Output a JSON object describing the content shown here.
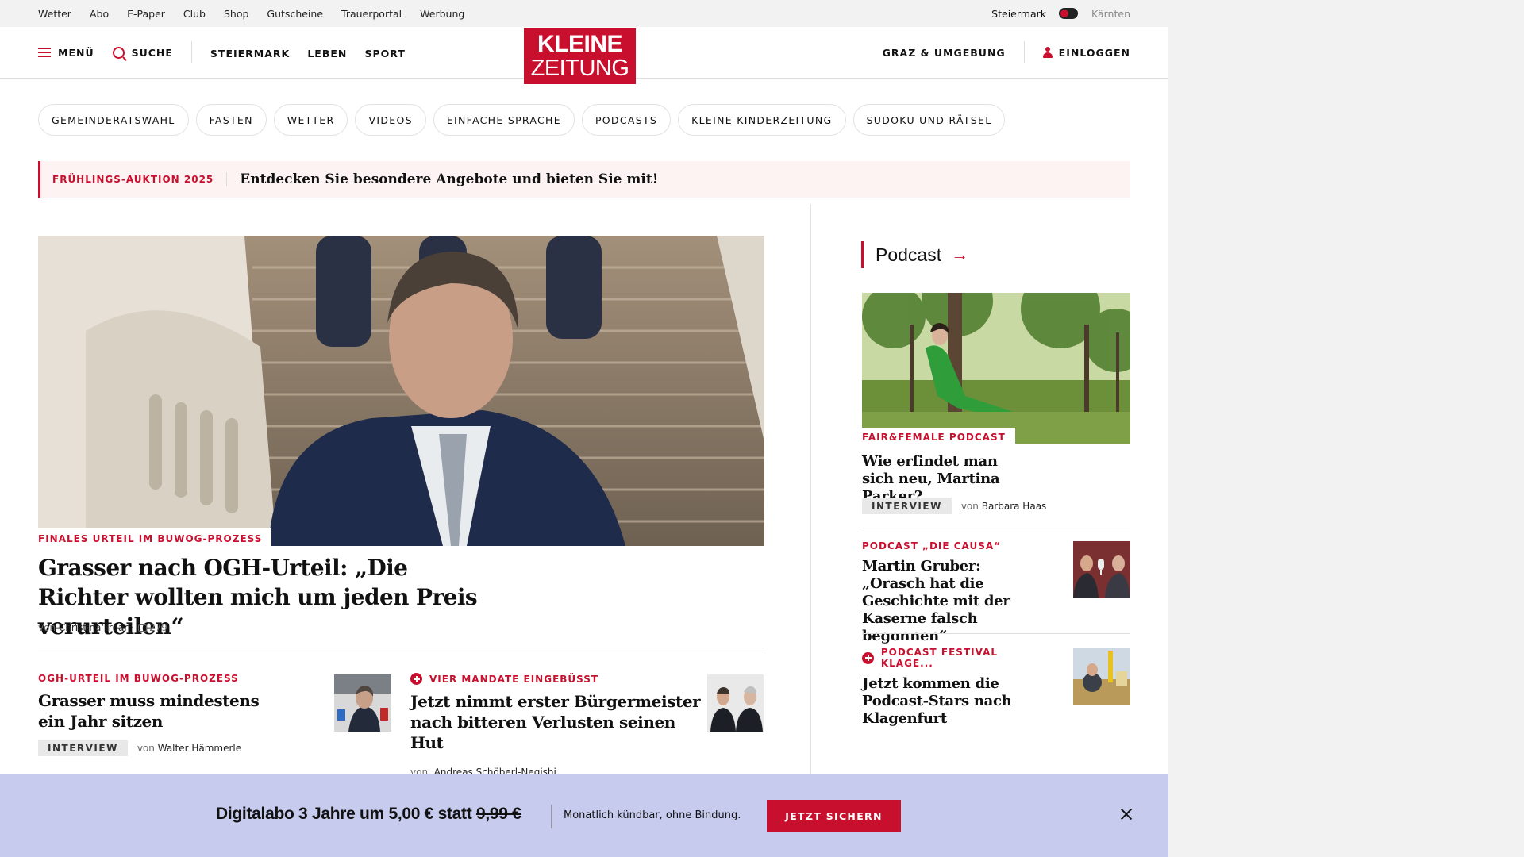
{
  "util_bar": {
    "links": [
      "Wetter",
      "Abo",
      "E-Paper",
      "Club",
      "Shop",
      "Gutscheine",
      "Trauerportal",
      "Werbung"
    ],
    "region_active": "Steiermark",
    "region_inactive": "Kärnten"
  },
  "header": {
    "menu_label": "MENÜ",
    "search_label": "SUCHE",
    "nav": [
      "STEIERMARK",
      "LEBEN",
      "SPORT"
    ],
    "logo_line1": "KLEINE",
    "logo_line2": "ZEITUNG",
    "region_link": "GRAZ & UMGEBUNG",
    "login_label": "EINLOGGEN"
  },
  "topics": [
    "GEMEINDERATSWAHL",
    "FASTEN",
    "WETTER",
    "VIDEOS",
    "EINFACHE SPRACHE",
    "PODCASTS",
    "KLEINE KINDERZEITUNG",
    "SUDOKU UND RÄTSEL"
  ],
  "promo": {
    "tag": "FRÜHLINGS-AUKTION 2025",
    "text": "Entdecken Sie besondere Angebote und bieten Sie mit!"
  },
  "hero": {
    "kicker": "FINALES URTEIL IM BUWOG-PROZESS",
    "title": "Grasser nach OGH-Urteil: „Die Richter wollten mich um jeden Preis verurteilen“",
    "by_prefix": "von",
    "author": "Christina Traar",
    "separator": "·",
    "comments": "279"
  },
  "articles": [
    {
      "kicker": "OGH-URTEIL IM BUWOG-PROZESS",
      "title": "Grasser muss mindestens ein Jahr sitzen",
      "badge": "INTERVIEW",
      "by_prefix": "von",
      "author": "Walter Hämmerle"
    },
    {
      "kicker": "VIER MANDATE EINGEBÜSST",
      "title": "Jetzt nimmt erster Bürgermeister nach bitteren Verlusten seinen Hut",
      "by_prefix": "von",
      "author": "Andreas Schöberl-Negishi"
    }
  ],
  "podcast": {
    "heading": "Podcast",
    "arrow": "→",
    "items": [
      {
        "kicker": "FAIR&FEMALE PODCAST",
        "title": "Wie erfindet man sich neu, Martina Parker?",
        "badge": "INTERVIEW",
        "by_prefix": "von",
        "author": "Barbara Haas"
      },
      {
        "kicker": "PODCAST „DIE CAUSA“",
        "title": "Martin Gruber: „Orasch hat die Geschichte mit der Kaserne falsch begonnen“"
      },
      {
        "kicker": "PODCAST FESTIVAL KLAGE...",
        "title": "Jetzt kommen die Podcast-Stars nach Klagenfurt"
      }
    ]
  },
  "banner": {
    "offer_prefix": "Digitalabo 3 Jahre um 5,00 € statt",
    "old_price": "9,99 €",
    "subtext": "Monatlich kündbar, ohne Bindung.",
    "cta": "JETZT SICHERN"
  },
  "colors": {
    "brand_red": "#c8102e",
    "banner_bg": "#c7cbee",
    "util_bg": "#f2f2f2"
  }
}
